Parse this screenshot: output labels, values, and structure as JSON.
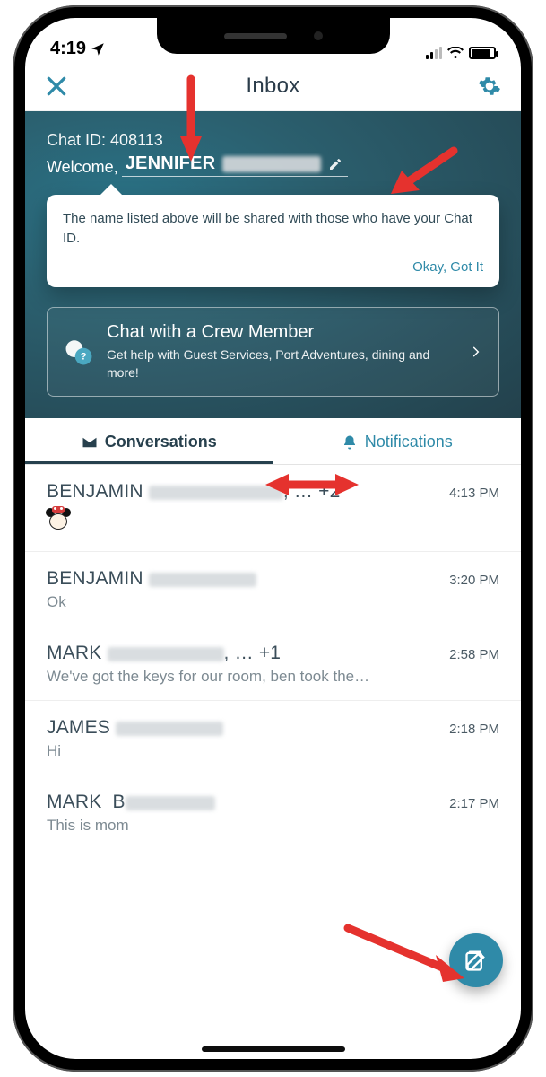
{
  "status": {
    "time": "4:19",
    "location_arrow": true
  },
  "navbar": {
    "title": "Inbox"
  },
  "hero": {
    "chat_id_label": "Chat ID:",
    "chat_id": "408113",
    "welcome": "Welcome,",
    "username": "JENNIFER",
    "tooltip": {
      "text": "The name listed above will be shared with those who have your Chat ID.",
      "ok": "Okay, Got It"
    },
    "crew": {
      "title": "Chat with a Crew Member",
      "subtitle": "Get help with Guest Services, Port Adventures, dining and more!"
    }
  },
  "tabs": {
    "conversations": "Conversations",
    "notifications": "Notifications"
  },
  "conversations": [
    {
      "name": "BENJAMIN",
      "suffix": ", … +2",
      "preview_emoji": true,
      "preview": "",
      "time": "4:13 PM"
    },
    {
      "name": "BENJAMIN",
      "suffix": "",
      "preview": "Ok",
      "time": "3:20 PM"
    },
    {
      "name": "MARK",
      "suffix": ", … +1",
      "preview": "We've got the keys for our room, ben took the…",
      "time": "2:58 PM"
    },
    {
      "name": "JAMES",
      "suffix": "",
      "preview": "Hi",
      "time": "2:18 PM"
    },
    {
      "name": "MARK",
      "suffix": "",
      "preview": "This is mom",
      "time": "2:17 PM",
      "name_partial": "B"
    }
  ]
}
